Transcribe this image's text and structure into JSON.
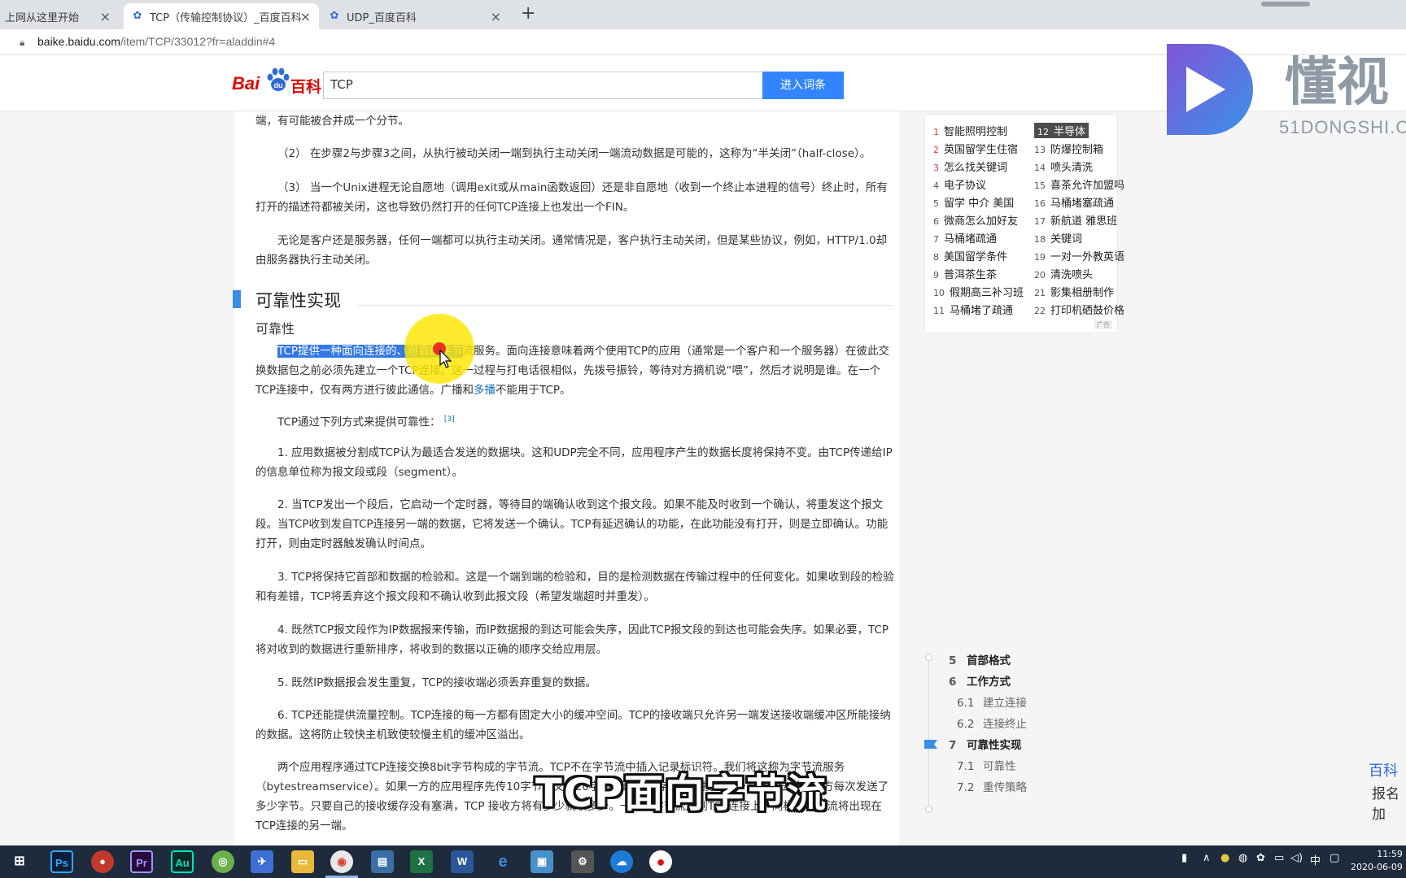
{
  "browser": {
    "tabs": [
      {
        "title": "上网从这里开始",
        "active": false
      },
      {
        "title": "TCP（传输控制协议）_百度百科",
        "active": true
      },
      {
        "title": "UDP_百度百科",
        "active": false
      }
    ],
    "new_tab": "+",
    "url_host": "baike.baidu.com",
    "url_path": "/item/TCP/33012?fr=aladdin#4"
  },
  "header": {
    "logo_bai": "Bai",
    "logo_ke": "百科",
    "search_value": "TCP",
    "search_button": "进入词条"
  },
  "article": {
    "p0": "端，有可能被合并成一个分节。",
    "p1": "（2） 在步骤2与步骤3之间，从执行被动关闭一端到执行主动关闭一端流动数据是可能的，这称为“半关闭”（half-close）。",
    "p2": "（3） 当一个Unix进程无论自愿地（调用exit或从main函数返回）还是非自愿地（收到一个终止本进程的信号）终止时，所有打开的描述符都被关闭，这也导致仍然打开的任何TCP连接上也发出一个FIN。",
    "p3": "无论是客户还是服务器，任何一端都可以执行主动关闭。通常情况是，客户执行主动关闭，但是某些协议，例如，HTTP/1.0却由服务器执行主动关闭。",
    "section_title": "可靠性实现",
    "sub_title": "可靠性",
    "p4_highlight": "TCP提供一种面向连接的、可靠的字节",
    "p4_rest1": "流服务。面向连接意味着两个使用TCP的应用（通常是一个客户和一个服务器）在彼此交换数据包之前必须先建立一个TCP连接。这一过程与打电话很相似，先拨号振铃，等待对方摘机说“喂”，然后才说明是谁。在一个TCP连接中，仅有两方进行彼此通信。广播和",
    "p4_link": "多播",
    "p4_rest2": "不能用于TCP。",
    "p5": "TCP通过下列方式来提供可靠性：",
    "p5_ref": "[3]",
    "p6": "1. 应用数据被分割成TCP认为最适合发送的数据块。这和UDP完全不同，应用程序产生的数据长度将保持不变。由TCP传递给IP的信息单位称为报文段或段（segment）。",
    "p7": "2. 当TCP发出一个段后，它启动一个定时器，等待目的端确认收到这个报文段。如果不能及时收到一个确认，将重发这个报文段。当TCP收到发自TCP连接另一端的数据，它将发送一个确认。TCP有延迟确认的功能，在此功能没有打开，则是立即确认。功能打开，则由定时器触发确认时间点。",
    "p8": "3. TCP将保持它首部和数据的检验和。这是一个端到端的检验和，目的是检测数据在传输过程中的任何变化。如果收到段的检验和有差错，TCP将丢弃这个报文段和不确认收到此报文段（希望发端超时并重发）。",
    "p9": "4. 既然TCP报文段作为IP数据报来传输，而IP数据报的到达可能会失序，因此TCP报文段的到达也可能会失序。如果必要，TCP将对收到的数据进行重新排序，将收到的数据以正确的顺序交给应用层。",
    "p10": "5. 既然IP数据报会发生重复，TCP的接收端必须丢弃重复的数据。",
    "p11": "6. TCP还能提供流量控制。TCP连接的每一方都有固定大小的缓冲空间。TCP的接收端只允许另一端发送接收端缓冲区所能接纳的数据。这将防止较快主机致使较慢主机的缓冲区溢出。",
    "p12": "两个应用程序通过TCP连接交换8bit字节构成的字节流。TCP不在字节流中插入记录标识符。我们将这称为字节流服务（bytestreamservice）。如果一方的应用程序先传10字节，又传20字节，再传50字节，连接的另一方将无法了解发方每次发送了多少字节。只要自己的接收缓存没有塞满，TCP 接收方将有多少就收多少。一端将字节流放到TCP连接上，同样的字节流将出现在TCP连接的另一端。"
  },
  "hot_list": [
    {
      "n": "1",
      "t": "智能照明控制"
    },
    {
      "n": "2",
      "t": "英国留学生住宿"
    },
    {
      "n": "3",
      "t": "怎么找关键词"
    },
    {
      "n": "4",
      "t": "电子协议"
    },
    {
      "n": "5",
      "t": "留学 中介 美国"
    },
    {
      "n": "6",
      "t": "微商怎么加好友"
    },
    {
      "n": "7",
      "t": "马桶堵疏通"
    },
    {
      "n": "8",
      "t": "美国留学条件"
    },
    {
      "n": "9",
      "t": "普洱茶生茶"
    },
    {
      "n": "10",
      "t": "假期高三补习班"
    },
    {
      "n": "11",
      "t": "马桶堵了疏通"
    },
    {
      "n": "12",
      "t": "半导体"
    },
    {
      "n": "13",
      "t": "防爆控制箱"
    },
    {
      "n": "14",
      "t": "喷头清洗"
    },
    {
      "n": "15",
      "t": "喜茶允许加盟吗"
    },
    {
      "n": "16",
      "t": "马桶堵塞疏通"
    },
    {
      "n": "17",
      "t": "新航道 雅思班"
    },
    {
      "n": "18",
      "t": "关键词"
    },
    {
      "n": "19",
      "t": "一对一外教英语"
    },
    {
      "n": "20",
      "t": "清洗喷头"
    },
    {
      "n": "21",
      "t": "影集相册制作"
    },
    {
      "n": "22",
      "t": "打印机硒鼓价格"
    }
  ],
  "ad_label": "广告",
  "catalog": [
    {
      "num": "5",
      "label": "首部格式",
      "level": 1
    },
    {
      "num": "6",
      "label": "工作方式",
      "level": 1
    },
    {
      "num": "6.1",
      "label": "建立连接",
      "level": 2
    },
    {
      "num": "6.2",
      "label": "连接终止",
      "level": 2
    },
    {
      "num": "7",
      "label": "可靠性实现",
      "level": 1,
      "current": true
    },
    {
      "num": "7.1",
      "label": "可靠性",
      "level": 2
    },
    {
      "num": "7.2",
      "label": "重传策略",
      "level": 2
    }
  ],
  "watermark": {
    "text": "懂视",
    "sub": "51DONGSHI.C"
  },
  "promo": {
    "line1": "百科",
    "line2": "报名加"
  },
  "caption": "TCP面向字节流",
  "taskbar": {
    "apps": [
      "Ps",
      "Pr",
      "Au",
      "X",
      "W"
    ],
    "tray_lang": "中",
    "time": "11:59",
    "date": "2020-06-09"
  },
  "colors": {
    "accent": "#3385ff",
    "highlight": "#3478e6",
    "section_bar": "#3a8ee6",
    "brand_red": "#e10602"
  }
}
